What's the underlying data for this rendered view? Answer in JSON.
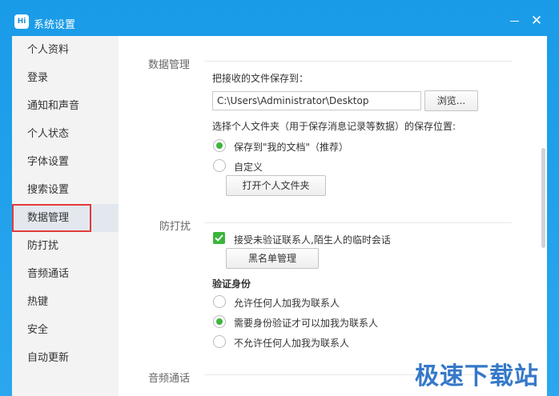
{
  "window": {
    "title": "系统设置",
    "app_icon_text": "Hi"
  },
  "sidebar": {
    "items": [
      {
        "label": "个人资料"
      },
      {
        "label": "登录"
      },
      {
        "label": "通知和声音"
      },
      {
        "label": "个人状态"
      },
      {
        "label": "字体设置"
      },
      {
        "label": "搜索设置"
      },
      {
        "label": "数据管理",
        "active": true
      },
      {
        "label": "防打扰"
      },
      {
        "label": "音频通话"
      },
      {
        "label": "热键"
      },
      {
        "label": "安全"
      },
      {
        "label": "自动更新"
      }
    ]
  },
  "data_mgmt": {
    "title": "数据管理",
    "save_to_label": "把接收的文件保存到：",
    "save_path": "C:\\Users\\Administrator\\Desktop",
    "browse_label": "浏览...",
    "folder_label": "选择个人文件夹（用于保存消息记录等数据）的保存位置:",
    "opt_my_docs": "保存到\"我的文档\"（推荐）",
    "opt_custom": "自定义",
    "open_folder_label": "打开个人文件夹"
  },
  "dnd": {
    "title": "防打扰",
    "accept_unverified": "接受未验证联系人,陌生人的临时会话",
    "blacklist_label": "黑名单管理",
    "verify_heading": "验证身份",
    "opt_allow_all": "允许任何人加我为联系人",
    "opt_need_verify": "需要身份验证才可以加我为联系人",
    "opt_deny_all": "不允许任何人加我为联系人"
  },
  "audio": {
    "title": "音频通话"
  },
  "watermark": "极速下载站",
  "colors": {
    "titlebar": "#1a9be8",
    "accent_green": "#3bb53b",
    "highlight_red": "#e13b3b"
  }
}
